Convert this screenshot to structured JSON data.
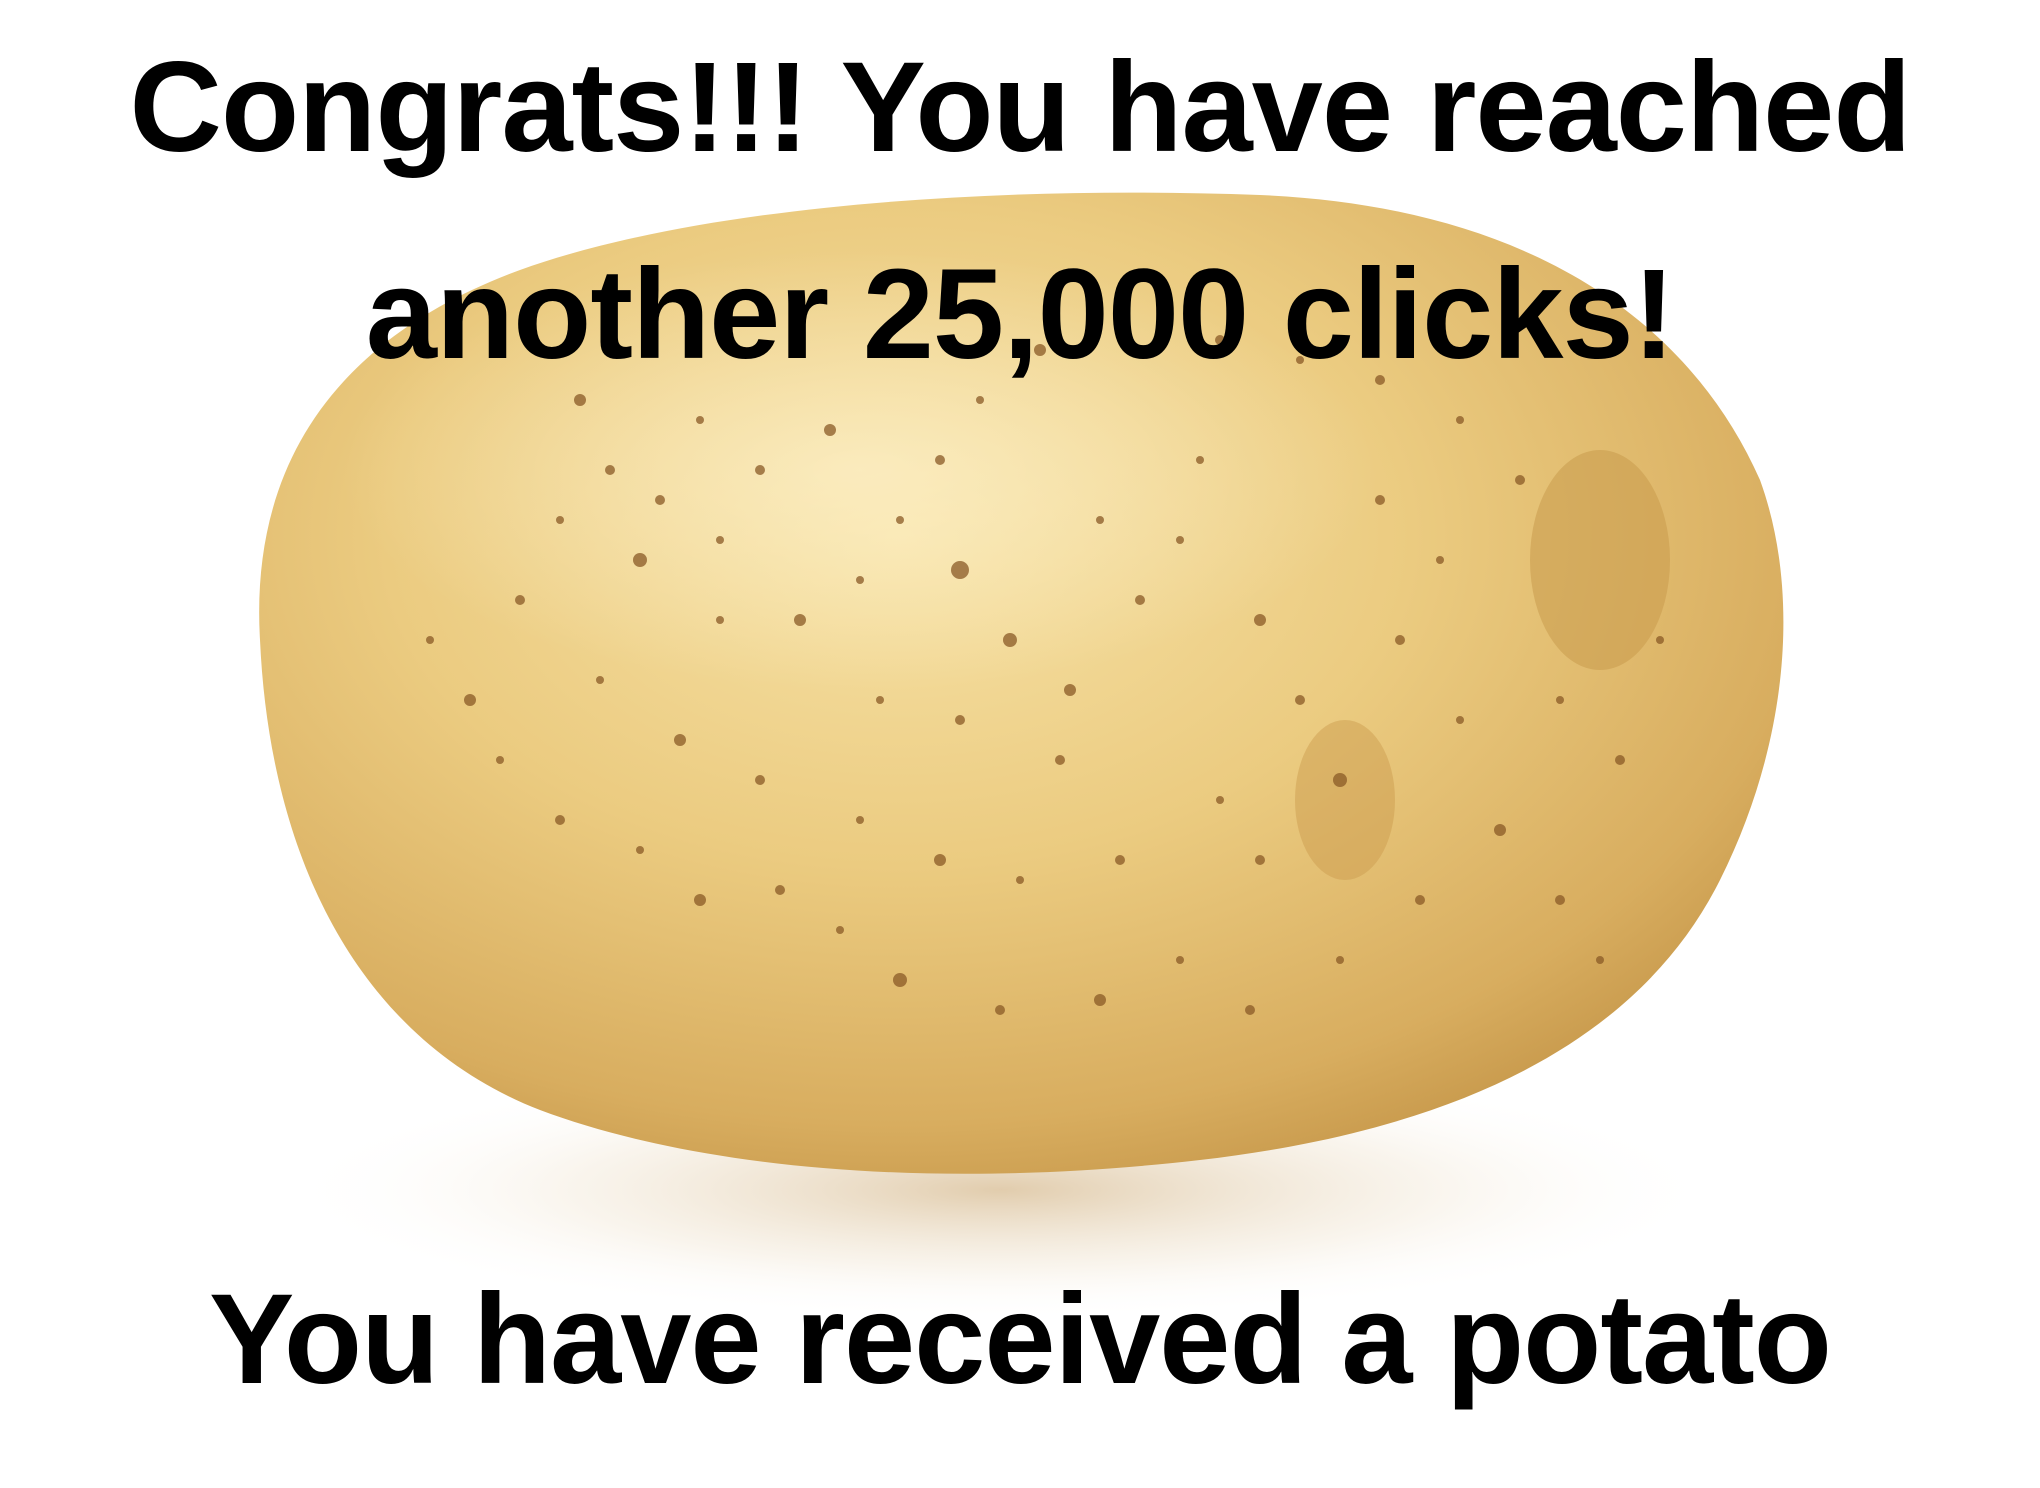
{
  "meme": {
    "top_line_1": "Congrats!!! You have reached",
    "top_line_2": "another 25,000 clicks!",
    "bottom_line": "You have received a potato"
  },
  "image": {
    "subject": "potato",
    "colors": {
      "background": "#ffffff",
      "skin_light": "#f0d58f",
      "skin_mid": "#ddb567",
      "skin_dark": "#b98b3e",
      "spots": "#8a5a26",
      "text": "#000000"
    }
  }
}
